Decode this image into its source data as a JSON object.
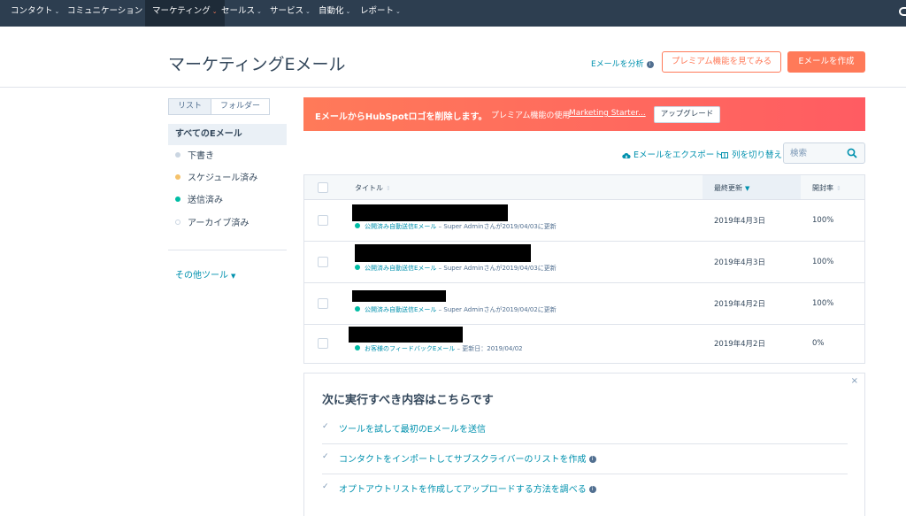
{
  "nav": {
    "items": [
      {
        "label": "コンタクト"
      },
      {
        "label": "コミュニケーション"
      },
      {
        "label": "マーケティング"
      },
      {
        "label": "セールス"
      },
      {
        "label": "サービス"
      },
      {
        "label": "自動化"
      },
      {
        "label": "レポート"
      }
    ],
    "active_index": 2
  },
  "header": {
    "title": "マーケティングEメール",
    "analyze_link": "Eメールを分析",
    "premium_button": "プレミアム機能を見てみる",
    "create_button": "Eメールを作成"
  },
  "sidebar": {
    "toggle": [
      "リスト",
      "フォルダー"
    ],
    "all_label": "すべてのEメール",
    "items": [
      {
        "label": "下書き",
        "dot_color": "#cbd6e2"
      },
      {
        "label": "スケジュール済み",
        "dot_color": "#f5c26b"
      },
      {
        "label": "送信済み",
        "dot_color": "#00bda5"
      },
      {
        "label": "アーカイブ済み",
        "dot_color": "#ffffff"
      }
    ],
    "other_tools": "その他ツール"
  },
  "banner": {
    "main": "EメールからHubSpotロゴを削除します。",
    "sub": "プレミアム機能の使用",
    "link": "Marketing Starter...",
    "button": "アップグレード"
  },
  "toolbar": {
    "export": "Eメールをエクスポート",
    "switch_columns": "列を切り替え",
    "search_placeholder": "検索"
  },
  "table": {
    "headers": {
      "title": "タイトル",
      "updated": "最終更新",
      "open_rate": "開封率"
    },
    "rows": [
      {
        "type": "公開済み自動送信Eメール",
        "sep": "–",
        "by": "Super Adminさんが2019/04/03に更新",
        "date": "2019年4月3日",
        "rate": "100%"
      },
      {
        "type": "公開済み自動送信Eメール",
        "sep": "–",
        "by": "Super Adminさんが2019/04/03に更新",
        "date": "2019年4月3日",
        "rate": "100%"
      },
      {
        "type": "公開済み自動送信Eメール",
        "sep": "–",
        "by": "Super Adminさんが2019/04/02に更新",
        "date": "2019年4月2日",
        "rate": "100%"
      },
      {
        "type": "お客様のフィードバックEメール",
        "sep": "–",
        "by": "更新日：2019/04/02",
        "date": "2019年4月2日",
        "rate": "0%"
      }
    ]
  },
  "next_steps": {
    "title": "次に実行すべき内容はこちらです",
    "close": "×",
    "items": [
      {
        "label": "ツールを試して最初のEメールを送信"
      },
      {
        "label": "コンタクトをインポートしてサブスクライバーのリストを作成"
      },
      {
        "label": "オプトアウトリストを作成してアップロードする方法を調べる"
      }
    ]
  }
}
